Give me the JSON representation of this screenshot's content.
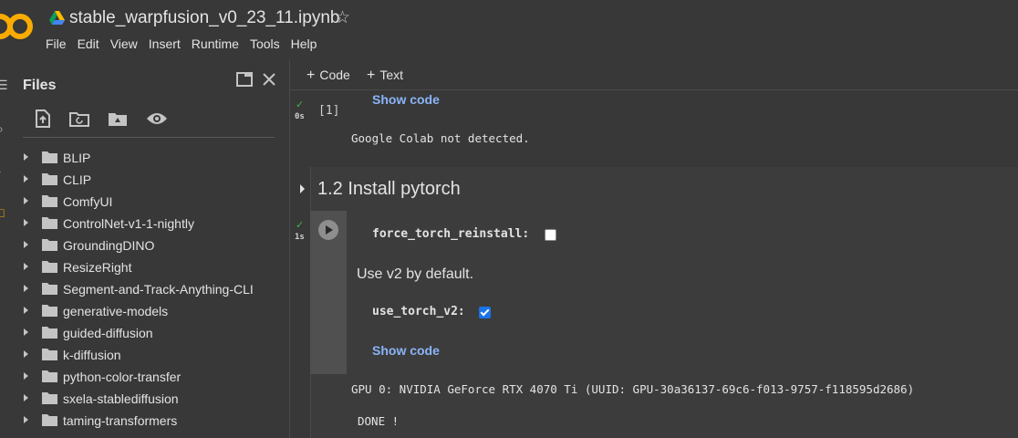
{
  "header": {
    "logo_text": "CO",
    "title": "stable_warpfusion_v0_23_11.ipynb",
    "menu": [
      "File",
      "Edit",
      "View",
      "Insert",
      "Runtime",
      "Tools",
      "Help"
    ]
  },
  "files": {
    "title": "Files",
    "items": [
      "BLIP",
      "CLIP",
      "ComfyUI",
      "ControlNet-v1-1-nightly",
      "GroundingDINO",
      "ResizeRight",
      "Segment-and-Track-Anything-CLI",
      "generative-models",
      "guided-diffusion",
      "k-diffusion",
      "python-color-transfer",
      "sxela-stablediffusion",
      "taming-transformers"
    ]
  },
  "toolbar": {
    "add_code": "Code",
    "add_text": "Text"
  },
  "cell1": {
    "exec_time": "0s",
    "exec_count": "[1]",
    "show_code": "Show code",
    "output": "Google Colab not detected."
  },
  "section": {
    "title": "1.2 Install pytorch"
  },
  "cell2": {
    "exec_time": "1s",
    "force_label": "force_torch_reinstall:",
    "force_checked": false,
    "note": "Use v2 by default.",
    "v2_label": "use_torch_v2:",
    "v2_checked": true,
    "show_code": "Show code",
    "output_gpu": "GPU 0: NVIDIA GeForce RTX 4070 Ti (UUID: GPU-30a36137-69c6-f013-9757-f118595d2686)",
    "output_done": "DONE !"
  },
  "colors": {
    "background": "#383838",
    "link": "#8ab4f8",
    "success": "#4caf50",
    "checkbox_on": "#1a73e8",
    "logo_orange": "#f9ab00"
  }
}
